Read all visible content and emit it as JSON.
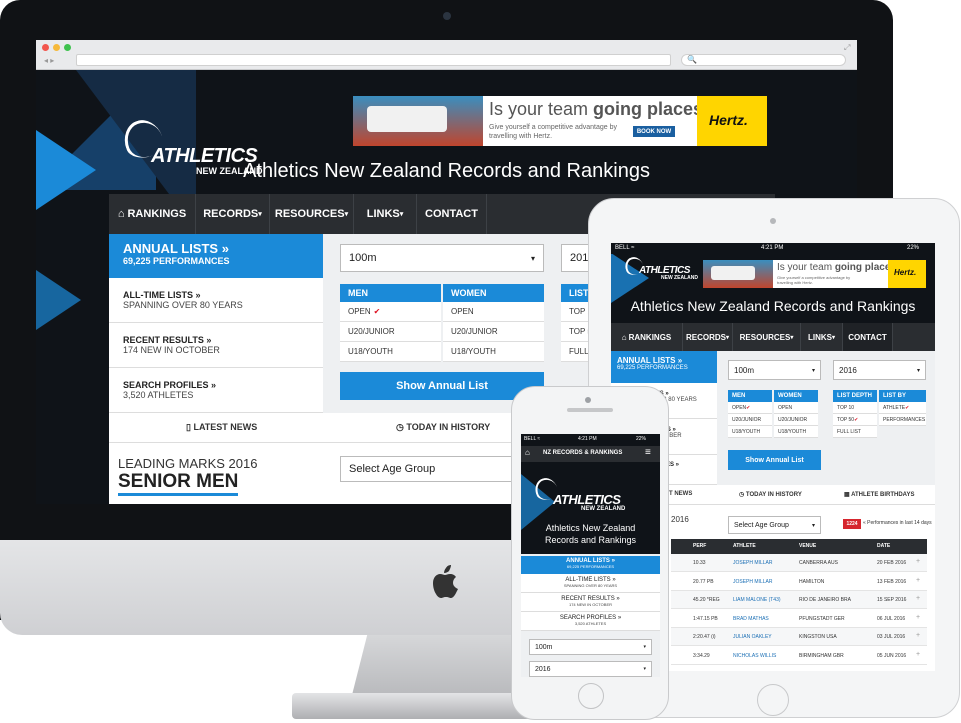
{
  "browser": {
    "search_placeholder": "🔍"
  },
  "site": {
    "logo_main": "ATHLETICS",
    "logo_sub": "NEW ZEALAND",
    "title": "Athletics New Zealand Records and Rankings"
  },
  "ad": {
    "headline_pre": "Is your team ",
    "headline_bold": "going places?",
    "body": "Give yourself a competitive advantage by travelling with Hertz.",
    "cta": "BOOK NOW",
    "brand": "Hertz."
  },
  "nav": {
    "rankings": "RANKINGS",
    "records": "RECORDS",
    "resources": "RESOURCES",
    "links": "LINKS",
    "contact": "CONTACT"
  },
  "sidebar": [
    {
      "title": "ANNUAL LISTS »",
      "sub": "69,225 PERFORMANCES"
    },
    {
      "title": "ALL-TIME LISTS »",
      "sub": "SPANNING OVER 80 YEARS"
    },
    {
      "title": "RECENT RESULTS »",
      "sub": "174 NEW IN OCTOBER"
    },
    {
      "title": "SEARCH PROFILES »",
      "sub": "3,520 ATHLETES"
    }
  ],
  "filters": {
    "event": "100m",
    "year": "2016",
    "age_group": "Select Age Group"
  },
  "table": {
    "men": "MEN",
    "women": "WOMEN",
    "list_depth": "LIST DEPTH",
    "list_by": "LIST BY",
    "men_rows": [
      "OPEN",
      "U20/JUNIOR",
      "U18/YOUTH"
    ],
    "women_rows": [
      "OPEN",
      "U20/JUNIOR",
      "U18/YOUTH"
    ],
    "depth_rows": [
      "TOP 10",
      "TOP 50",
      "FULL LIST"
    ],
    "depth_short": [
      "TOP 1(",
      "TOP 5(",
      "FULL LI"
    ],
    "by_rows": [
      "ATHLETE",
      "PERFORMANCES"
    ]
  },
  "show_btn": "Show Annual List",
  "tabs": {
    "news": "LATEST NEWS",
    "history": "TODAY IN HISTORY",
    "birthdays": "ATHLETE BIRTHDAYS",
    "news_short": "EST NEWS"
  },
  "leading": {
    "line1": "LEADING MARKS 2016",
    "line2": "SENIOR MEN",
    "line_tab": "2016"
  },
  "perf_badge": "1224",
  "perf_note": "« Performances in last 14 days",
  "ipad_status": {
    "carrier": "BELL ≈",
    "time": "4:21 PM",
    "battery": "22%"
  },
  "iphone_status": {
    "carrier": "BELL ≈",
    "time": "4:21 PM",
    "battery": "22%"
  },
  "iphone_nav": "NZ RECORDS & RANKINGS",
  "iphone_sidebar_partial": [
    {
      "title": "LISTS »",
      "sub": "VER 80 YEARS"
    },
    {
      "title": "IS »",
      "sub": "OCTOBER"
    },
    {
      "title": "ES »",
      "sub": "S"
    }
  ],
  "results": {
    "headers": [
      "PERF",
      "ATHLETE",
      "VENUE",
      "DATE"
    ],
    "rows": [
      {
        "perf": "10.33",
        "athlete": "JOSEPH MILLAR",
        "venue": "CANBERRA AUS",
        "date": "20 FEB 2016"
      },
      {
        "perf": "20.77 PB",
        "athlete": "JOSEPH MILLAR",
        "venue": "HAMILTON",
        "date": "13 FEB 2016"
      },
      {
        "perf": "45.20 *REG",
        "athlete": "LIAM MALONE (T43)",
        "venue": "RIO DE JANEIRO BRA",
        "date": "15 SEP 2016"
      },
      {
        "perf": "1:47.15 PB",
        "athlete": "BRAD MATHAS",
        "venue": "PFUNGSTADT GER",
        "date": "06 JUL 2016"
      },
      {
        "perf": "2:20.47 (i)",
        "athlete": "JULIAN OAKLEY",
        "venue": "KINGSTON USA",
        "date": "03 JUL 2016"
      },
      {
        "perf": "3:34.29",
        "athlete": "NICHOLAS WILLIS",
        "venue": "BIRMINGHAM GBR",
        "date": "05 JUN 2016"
      }
    ]
  },
  "colors": {
    "accent": "#1b8ad8",
    "dark": "#2a2d31",
    "hertz": "#ffd500"
  }
}
